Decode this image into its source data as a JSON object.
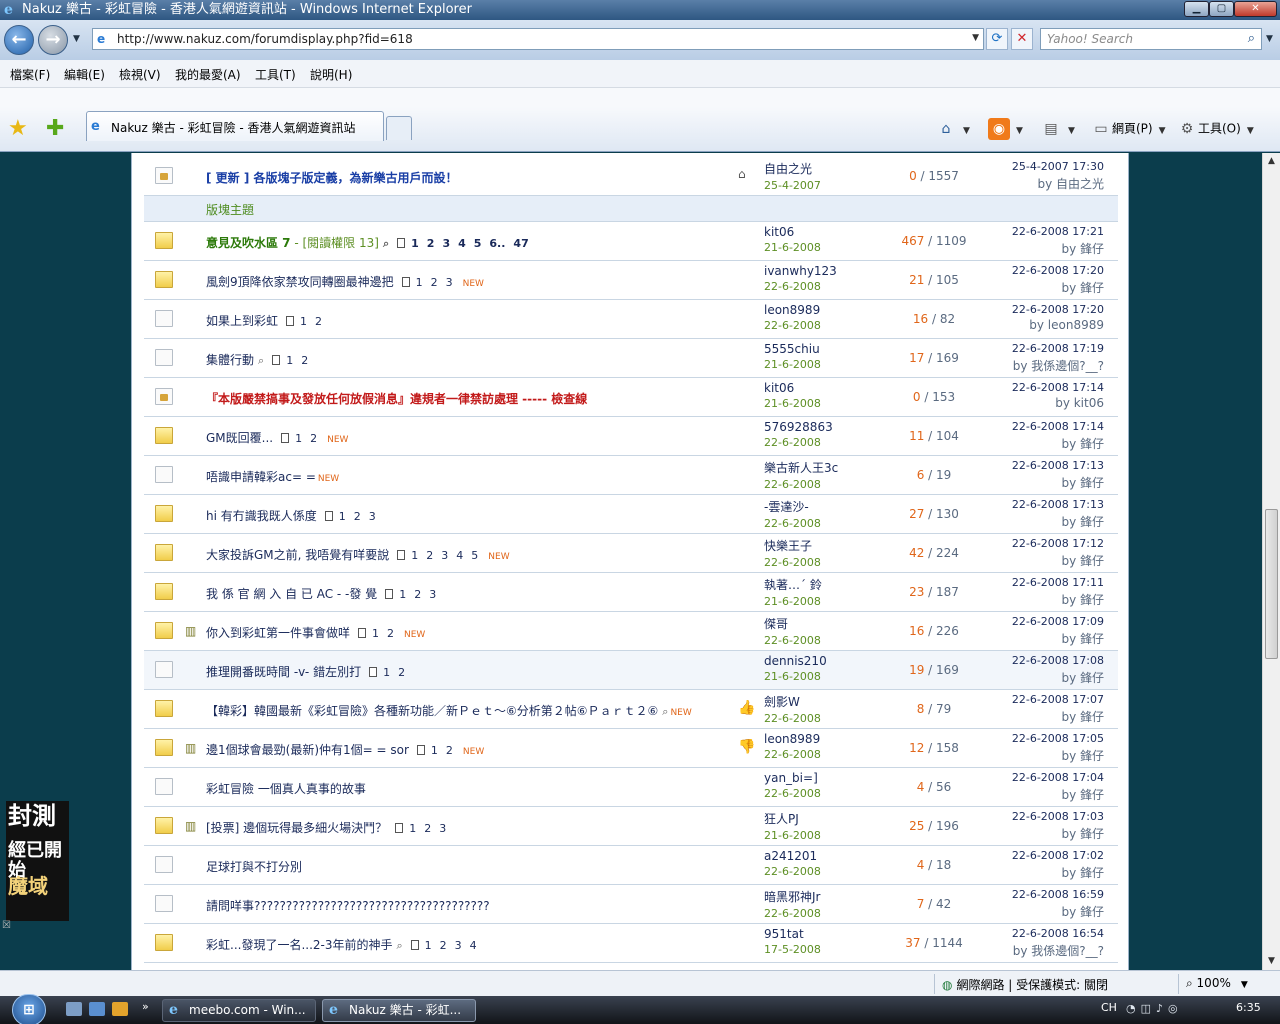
{
  "window": {
    "title": "Nakuz 樂古 - 彩虹冒險 - 香港人氣網遊資訊站 - Windows Internet Explorer"
  },
  "address": {
    "url": "http://www.nakuz.com/forumdisplay.php?fid=618",
    "search_placeholder": "Yahoo! Search"
  },
  "menu": [
    "檔案(F)",
    "編輯(E)",
    "檢視(V)",
    "我的最愛(A)",
    "工具(T)",
    "說明(H)"
  ],
  "tab": {
    "label": "Nakuz 樂古 - 彩虹冒險 - 香港人氣網遊資訊站"
  },
  "toolbar": {
    "page_label": "網頁(P)",
    "tools_label": "工具(O)"
  },
  "forum": {
    "section_label": "版塊主題",
    "announcement": {
      "subject": "[ 更新 ] 各版塊子版定義，為新樂古用戶而設！",
      "author": "自由之光",
      "date": "25-4-2007",
      "replies": "0",
      "views": "1557",
      "last_time": "25-4-2007 17:30",
      "last_by": "by 自由之光"
    },
    "threads": [
      {
        "icon": "hot",
        "style": "sticky",
        "subject": "意見及吹水區 7",
        "extra": " - [閱讀權限 13]",
        "clip": true,
        "pages": [
          "1",
          "2",
          "3",
          "4",
          "5",
          "6..",
          "47"
        ],
        "new": false,
        "mood": "",
        "poll": false,
        "author": "kit06",
        "date": "21-6-2008",
        "replies": "467",
        "views": "1109",
        "last_time": "22-6-2008 17:21",
        "last_by": "by 鋒仔",
        "hl": false
      },
      {
        "icon": "hot",
        "style": "",
        "subject": "風劍9頂降依家禁攻同轉圈最神邊把",
        "extra": "",
        "clip": false,
        "pages": [
          "1",
          "2",
          "3"
        ],
        "new": true,
        "mood": "",
        "poll": false,
        "author": "ivanwhy123",
        "date": "22-6-2008",
        "replies": "21",
        "views": "105",
        "last_time": "22-6-2008 17:20",
        "last_by": "by 鋒仔",
        "hl": false
      },
      {
        "icon": "new",
        "style": "",
        "subject": "如果上到彩虹",
        "extra": "",
        "clip": false,
        "pages": [
          "1",
          "2"
        ],
        "new": false,
        "mood": "",
        "poll": false,
        "author": "leon8989",
        "date": "22-6-2008",
        "replies": "16",
        "views": "82",
        "last_time": "22-6-2008 17:20",
        "last_by": "by leon8989",
        "hl": false
      },
      {
        "icon": "new",
        "style": "",
        "subject": "集體行動",
        "extra": "",
        "clip": true,
        "pages": [
          "1",
          "2"
        ],
        "new": false,
        "mood": "",
        "poll": false,
        "author": "5555chiu",
        "date": "21-6-2008",
        "replies": "17",
        "views": "169",
        "last_time": "22-6-2008 17:19",
        "last_by": "by 我係邊個?__?",
        "hl": false
      },
      {
        "icon": "lock",
        "style": "warn",
        "subject": "『本版嚴禁搞事及發放任何放假消息』違規者一律禁訪處理 ----- 檢查線",
        "extra": "",
        "clip": false,
        "pages": [],
        "new": false,
        "mood": "",
        "poll": false,
        "author": "kit06",
        "date": "21-6-2008",
        "replies": "0",
        "views": "153",
        "last_time": "22-6-2008 17:14",
        "last_by": "by kit06",
        "hl": false
      },
      {
        "icon": "hot",
        "style": "",
        "subject": "GM既回覆...",
        "extra": "",
        "clip": false,
        "pages": [
          "1",
          "2"
        ],
        "new": true,
        "mood": "",
        "poll": false,
        "author": "576928863",
        "date": "22-6-2008",
        "replies": "11",
        "views": "104",
        "last_time": "22-6-2008 17:14",
        "last_by": "by 鋒仔",
        "hl": false
      },
      {
        "icon": "new",
        "style": "",
        "subject": "唔識申請韓彩ac= =",
        "extra": "",
        "clip": false,
        "pages": [],
        "new": true,
        "mood": "",
        "poll": false,
        "author": "樂古新人王3c",
        "date": "22-6-2008",
        "replies": "6",
        "views": "19",
        "last_time": "22-6-2008 17:13",
        "last_by": "by 鋒仔",
        "hl": false
      },
      {
        "icon": "hot",
        "style": "",
        "subject": "hi 有冇識我既人係度",
        "extra": "",
        "clip": false,
        "pages": [
          "1",
          "2",
          "3"
        ],
        "new": false,
        "mood": "",
        "poll": false,
        "author": "-雲達沙-",
        "date": "22-6-2008",
        "replies": "27",
        "views": "130",
        "last_time": "22-6-2008 17:13",
        "last_by": "by 鋒仔",
        "hl": false
      },
      {
        "icon": "hot",
        "style": "",
        "subject": "大家投訴GM之前, 我唔覺有咩要說",
        "extra": "",
        "clip": false,
        "pages": [
          "1",
          "2",
          "3",
          "4",
          "5"
        ],
        "new": true,
        "mood": "",
        "poll": false,
        "author": "快樂王子",
        "date": "22-6-2008",
        "replies": "42",
        "views": "224",
        "last_time": "22-6-2008 17:12",
        "last_by": "by 鋒仔",
        "hl": false
      },
      {
        "icon": "hot",
        "style": "",
        "subject": "我 係 官 網 入 自 已 AC - -發 覺",
        "extra": "",
        "clip": false,
        "pages": [
          "1",
          "2",
          "3"
        ],
        "new": false,
        "mood": "",
        "poll": false,
        "author": "執著…´ 鈴",
        "date": "21-6-2008",
        "replies": "23",
        "views": "187",
        "last_time": "22-6-2008 17:11",
        "last_by": "by 鋒仔",
        "hl": false
      },
      {
        "icon": "hot",
        "style": "",
        "subject": "你入到彩虹第一件事會做咩",
        "extra": "",
        "clip": false,
        "pages": [
          "1",
          "2"
        ],
        "new": true,
        "mood": "",
        "poll": true,
        "author": "傑哥",
        "date": "22-6-2008",
        "replies": "16",
        "views": "226",
        "last_time": "22-6-2008 17:09",
        "last_by": "by 鋒仔",
        "hl": false
      },
      {
        "icon": "new",
        "style": "",
        "subject": "推理開番既時間 -v- 錯左別打",
        "extra": "",
        "clip": false,
        "pages": [
          "1",
          "2"
        ],
        "new": false,
        "mood": "",
        "poll": false,
        "author": "dennis210",
        "date": "21-6-2008",
        "replies": "19",
        "views": "169",
        "last_time": "22-6-2008 17:08",
        "last_by": "by 鋒仔",
        "hl": true
      },
      {
        "icon": "hot",
        "style": "",
        "subject": "【韓彩】韓國最新《彩虹冒險》各種新功能／新Ｐｅｔ～⑥分析第２帖⑥Ｐａｒｔ２⑥",
        "extra": "",
        "clip": true,
        "pages": [],
        "new": true,
        "mood": "👍",
        "poll": false,
        "author": "劍影W",
        "date": "22-6-2008",
        "replies": "8",
        "views": "79",
        "last_time": "22-6-2008 17:07",
        "last_by": "by 鋒仔",
        "hl": false
      },
      {
        "icon": "hot",
        "style": "",
        "subject": "邊1個球會最勁(最新)仲有1個= = sor",
        "extra": "",
        "clip": false,
        "pages": [
          "1",
          "2"
        ],
        "new": true,
        "mood": "👎",
        "poll": true,
        "author": "leon8989",
        "date": "22-6-2008",
        "replies": "12",
        "views": "158",
        "last_time": "22-6-2008 17:05",
        "last_by": "by 鋒仔",
        "hl": false
      },
      {
        "icon": "new",
        "style": "",
        "subject": "彩虹冒險 一個真人真事的故事",
        "extra": "",
        "clip": false,
        "pages": [],
        "new": false,
        "mood": "",
        "poll": false,
        "author": "yan_bi=]",
        "date": "22-6-2008",
        "replies": "4",
        "views": "56",
        "last_time": "22-6-2008 17:04",
        "last_by": "by 鋒仔",
        "hl": false
      },
      {
        "icon": "hot",
        "style": "",
        "subject": "[投票] 邊個玩得最多細火場決鬥？",
        "extra": "",
        "clip": false,
        "pages": [
          "1",
          "2",
          "3"
        ],
        "new": false,
        "mood": "",
        "poll": true,
        "author": "狂人PJ",
        "date": "21-6-2008",
        "replies": "25",
        "views": "196",
        "last_time": "22-6-2008 17:03",
        "last_by": "by 鋒仔",
        "hl": false
      },
      {
        "icon": "new",
        "style": "",
        "subject": "足球打與不打分別",
        "extra": "",
        "clip": false,
        "pages": [],
        "new": false,
        "mood": "",
        "poll": false,
        "author": "a241201",
        "date": "22-6-2008",
        "replies": "4",
        "views": "18",
        "last_time": "22-6-2008 17:02",
        "last_by": "by 鋒仔",
        "hl": false
      },
      {
        "icon": "new",
        "style": "",
        "subject": "請問咩事?????????????????????????????????????",
        "extra": "",
        "clip": false,
        "pages": [],
        "new": false,
        "mood": "",
        "poll": false,
        "author": "暗黑邪神Jr",
        "date": "22-6-2008",
        "replies": "7",
        "views": "42",
        "last_time": "22-6-2008 16:59",
        "last_by": "by 鋒仔",
        "hl": false
      },
      {
        "icon": "hot",
        "style": "",
        "subject": "彩虹...發現了一名...2-3年前的神手",
        "extra": "",
        "clip": true,
        "pages": [
          "1",
          "2",
          "3",
          "4"
        ],
        "new": false,
        "mood": "",
        "poll": false,
        "author": "951tat",
        "date": "17-5-2008",
        "replies": "37",
        "views": "1144",
        "last_time": "22-6-2008 16:54",
        "last_by": "by 我係邊個?__?",
        "hl": false
      }
    ]
  },
  "side_ad": {
    "line1": "封測",
    "line2": "經已開始",
    "line3": "魔域"
  },
  "status": {
    "zone": "網際網路 | 受保護模式: 關閉",
    "zoom": "100%"
  },
  "taskbar": {
    "items": [
      "meebo.com - Win...",
      "Nakuz 樂古 - 彩虹..."
    ],
    "lang": "CH",
    "time": "6:35"
  }
}
